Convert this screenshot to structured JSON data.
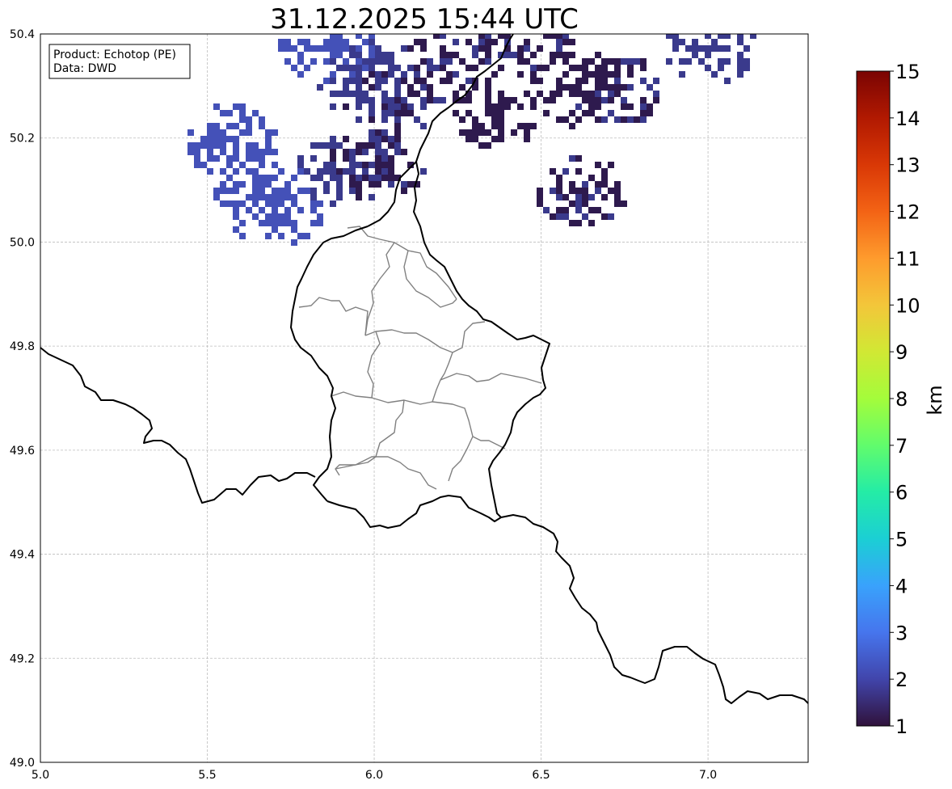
{
  "title": "31.12.2025 15:44 UTC",
  "info_box": {
    "product_line": "Product: Echotop (PE)",
    "data_line": "Data: DWD"
  },
  "axes": {
    "xlim": [
      5.0,
      7.3
    ],
    "ylim": [
      49.0,
      50.4
    ],
    "x_ticks": [
      5.0,
      5.5,
      6.0,
      6.5,
      7.0
    ],
    "x_tick_labels": [
      "5.0",
      "5.5",
      "6.0",
      "6.5",
      "7.0"
    ],
    "y_ticks": [
      49.0,
      49.2,
      49.4,
      49.6,
      49.8,
      50.0,
      50.2,
      50.4
    ],
    "y_tick_labels": [
      "49.0",
      "49.2",
      "49.4",
      "49.6",
      "49.8",
      "50.0",
      "50.2",
      "50.4"
    ],
    "grid": true
  },
  "colorbar": {
    "unit": "km",
    "min": 1,
    "max": 15,
    "tick_labels": [
      "1",
      "2",
      "3",
      "4",
      "5",
      "6",
      "7",
      "8",
      "9",
      "10",
      "11",
      "12",
      "13",
      "14",
      "15"
    ],
    "colormap": "turbo",
    "stops": [
      "#30123b",
      "#4145ab",
      "#4675ed",
      "#39a2fc",
      "#1bcfd4",
      "#24eca6",
      "#61fc6c",
      "#a4fc3b",
      "#d1e834",
      "#f3c63a",
      "#fe9b2d",
      "#f36315",
      "#d93806",
      "#b11901",
      "#7a0403"
    ]
  },
  "colors": {
    "echo_dark": "#2e1a4e",
    "echo_mid": "#3a3a8c",
    "echo_light": "#4451b8",
    "national_border": "#000000",
    "regional_border": "#808080"
  },
  "chart_data": {
    "type": "heatmap",
    "description_unit": "echotop height (km)",
    "xlim": [
      5.0,
      7.3
    ],
    "ylim": [
      49.0,
      50.4
    ],
    "value_range": [
      1,
      15
    ],
    "clusters": [
      {
        "lon": 5.95,
        "lat": 50.32,
        "value": 1.6
      },
      {
        "lon": 6.05,
        "lat": 50.27,
        "value": 1.4
      },
      {
        "lon": 6.2,
        "lat": 50.35,
        "value": 1.3
      },
      {
        "lon": 6.35,
        "lat": 50.25,
        "value": 1.2
      },
      {
        "lon": 6.45,
        "lat": 50.38,
        "value": 1.3
      },
      {
        "lon": 6.6,
        "lat": 50.3,
        "value": 1.2
      },
      {
        "lon": 6.72,
        "lat": 50.3,
        "value": 1.3
      },
      {
        "lon": 5.7,
        "lat": 50.06,
        "value": 2.0
      },
      {
        "lon": 5.9,
        "lat": 50.14,
        "value": 1.5
      },
      {
        "lon": 6.0,
        "lat": 50.15,
        "value": 1.3
      },
      {
        "lon": 5.65,
        "lat": 50.12,
        "value": 2.0
      },
      {
        "lon": 5.85,
        "lat": 50.38,
        "value": 2.0
      },
      {
        "lon": 5.55,
        "lat": 50.2,
        "value": 2.1
      },
      {
        "lon": 7.0,
        "lat": 50.38,
        "value": 1.6
      },
      {
        "lon": 6.6,
        "lat": 50.1,
        "value": 1.3
      }
    ]
  }
}
